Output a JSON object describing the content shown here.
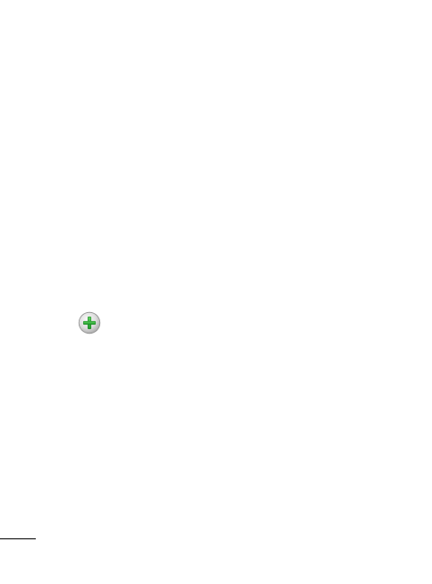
{
  "add_button": {
    "icon": "plus-icon",
    "accent_color": "#2fae2f",
    "face_color": "#d9d9d9"
  },
  "footer_rule": {
    "color": "#000000"
  }
}
